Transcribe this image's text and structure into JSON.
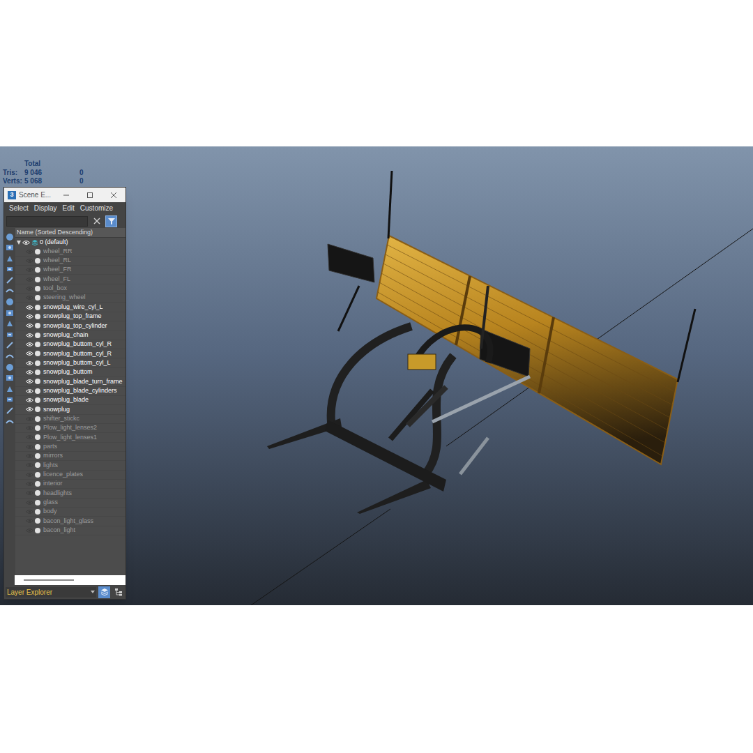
{
  "viewport": {
    "stats": {
      "header": "Total",
      "rows": [
        {
          "label": "Tris:",
          "total": "9 046",
          "selected": "0"
        },
        {
          "label": "Verts:",
          "total": "5 068",
          "selected": "0"
        }
      ]
    }
  },
  "scene_explorer": {
    "app_icon": "3",
    "title": "Scene E...",
    "menu": [
      "Select",
      "Display",
      "Edit",
      "Customize"
    ],
    "search": {
      "value": ""
    },
    "filter_active": true,
    "column_header": "Name (Sorted Descending)",
    "root": {
      "label": "0 (default)",
      "expanded": true,
      "visible": true
    },
    "items": [
      {
        "label": "wheel_RR",
        "visible": false
      },
      {
        "label": "wheel_RL",
        "visible": false
      },
      {
        "label": "wheel_FR",
        "visible": false
      },
      {
        "label": "wheel_FL",
        "visible": false
      },
      {
        "label": "tool_box",
        "visible": false
      },
      {
        "label": "steering_wheel",
        "visible": false
      },
      {
        "label": "snowplug_wire_cyl_L",
        "visible": true
      },
      {
        "label": "snowplug_top_frame",
        "visible": true
      },
      {
        "label": "snowplug_top_cylinder",
        "visible": true
      },
      {
        "label": "snowplug_chain",
        "visible": true
      },
      {
        "label": "snowplug_buttom_cyl_R",
        "visible": true
      },
      {
        "label": "snowplug_buttom_cyl_R",
        "visible": true
      },
      {
        "label": "snowplug_buttom_cyl_L",
        "visible": true
      },
      {
        "label": "snowplug_buttom",
        "visible": true
      },
      {
        "label": "snowplug_blade_turn_frame",
        "visible": true
      },
      {
        "label": "snowplug_blade_cylinders",
        "visible": true
      },
      {
        "label": "snowplug_blade",
        "visible": true
      },
      {
        "label": "snowplug",
        "visible": true
      },
      {
        "label": "shifter_stickc",
        "visible": false
      },
      {
        "label": "Plow_light_lenses2",
        "visible": false
      },
      {
        "label": "Plow_light_lenses1",
        "visible": false
      },
      {
        "label": "parts",
        "visible": false
      },
      {
        "label": "mirrors",
        "visible": false
      },
      {
        "label": "lights",
        "visible": false
      },
      {
        "label": "licence_plates",
        "visible": false
      },
      {
        "label": "interior",
        "visible": false
      },
      {
        "label": "headlights",
        "visible": false
      },
      {
        "label": "glass",
        "visible": false
      },
      {
        "label": "body",
        "visible": false
      },
      {
        "label": "bacon_light_glass",
        "visible": false
      },
      {
        "label": "bacon_light",
        "visible": false
      }
    ],
    "explorer_mode": "Layer Explorer",
    "view_buttons": [
      {
        "selected": true
      },
      {
        "selected": false
      }
    ]
  }
}
